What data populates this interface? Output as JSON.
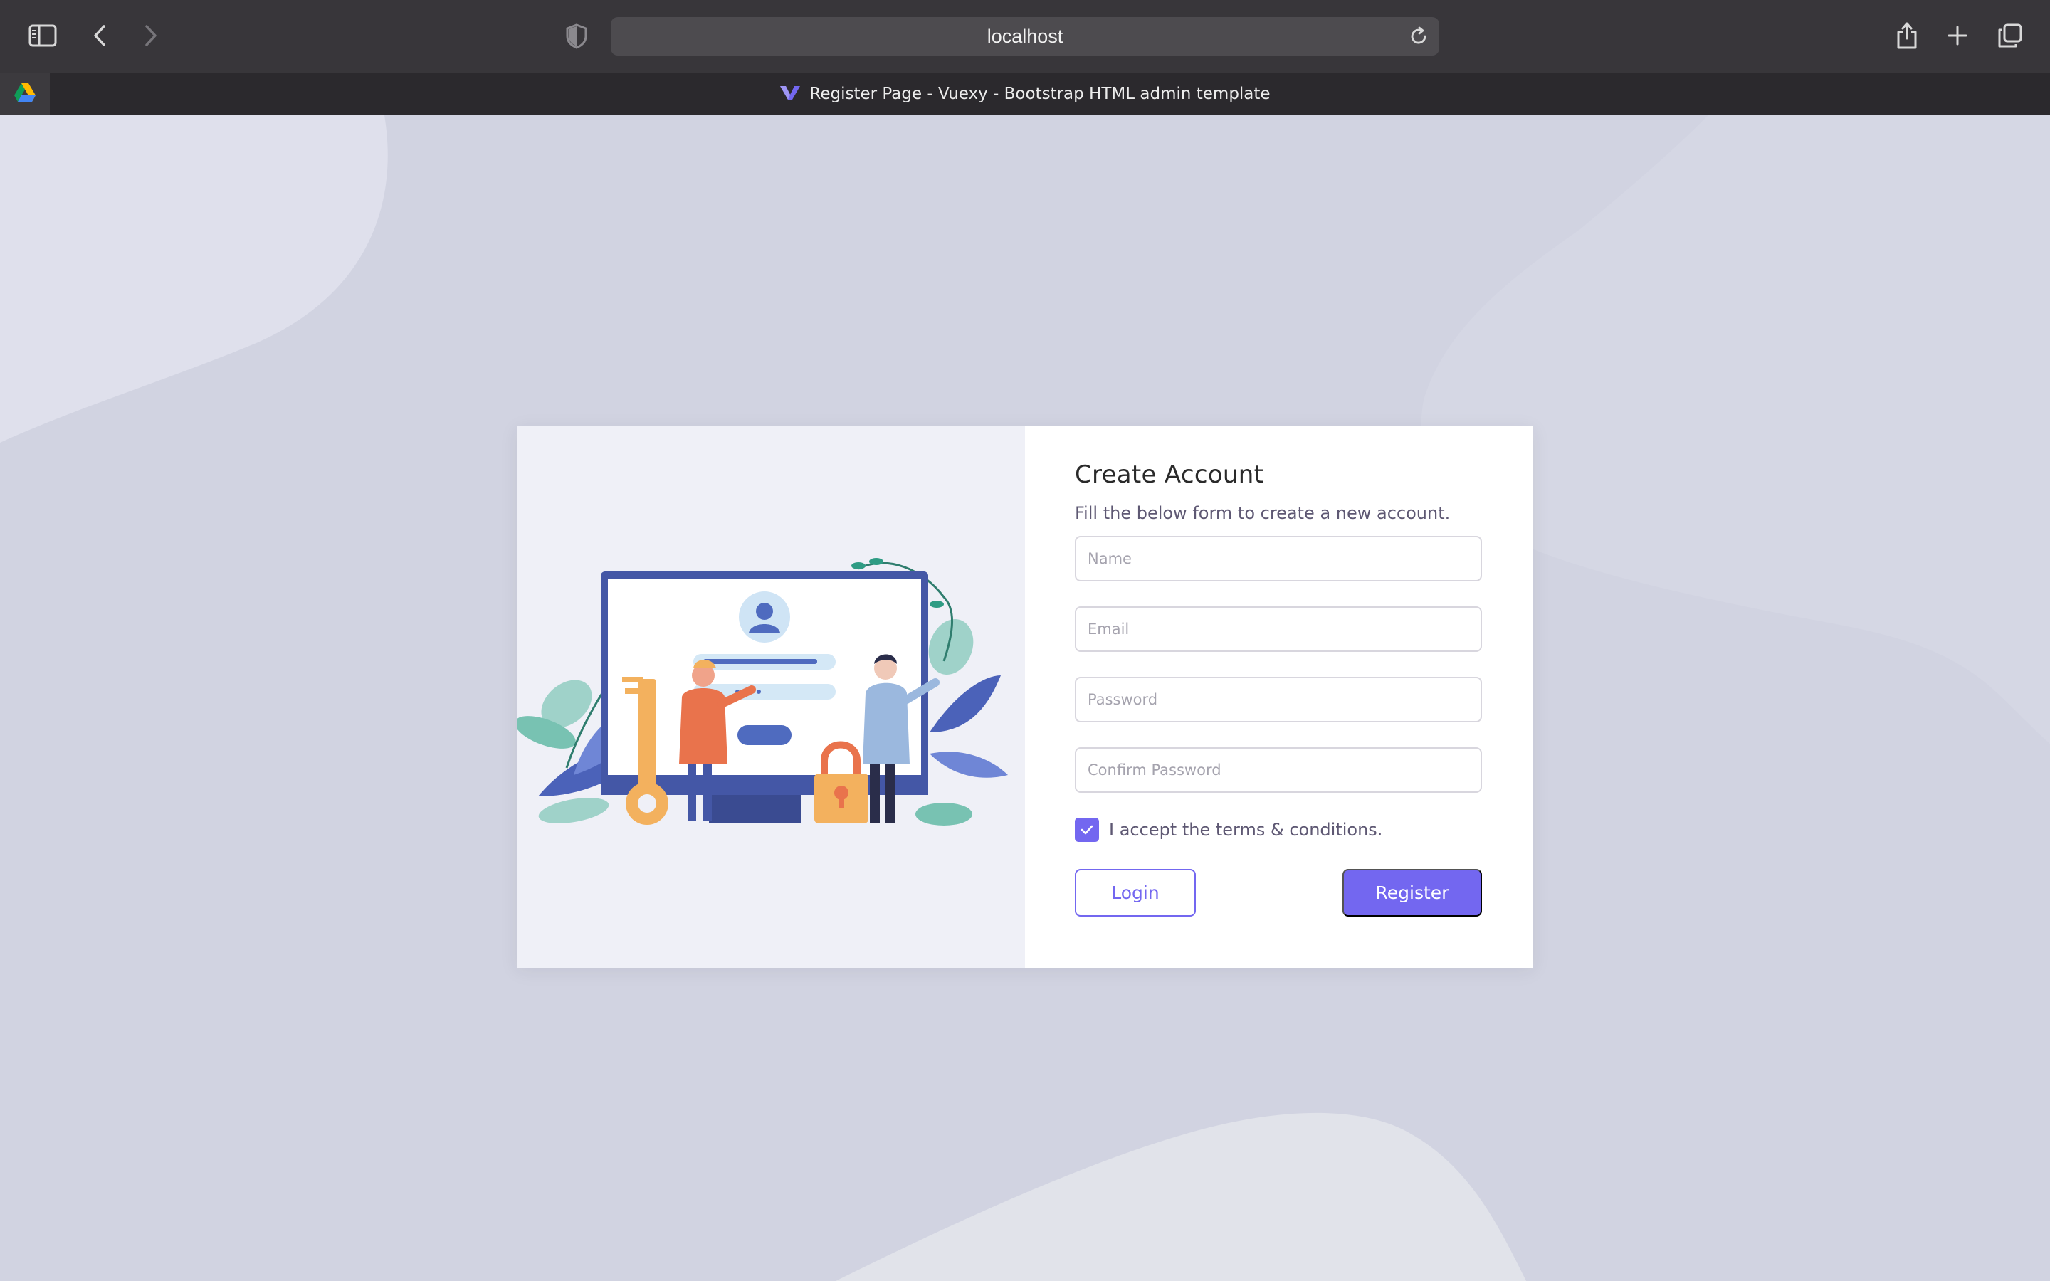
{
  "browser": {
    "url": "localhost",
    "tab_title": "Register Page - Vuexy - Bootstrap HTML admin template",
    "icons": [
      "sidebar-icon",
      "back-icon",
      "forward-icon",
      "shield-icon",
      "reload-icon",
      "share-icon",
      "new-tab-icon",
      "tab-overview-icon",
      "google-drive-icon",
      "vuexy-logo-icon"
    ]
  },
  "form": {
    "title": "Create Account",
    "subtitle": "Fill the below form to create a new account.",
    "name_placeholder": "Name",
    "email_placeholder": "Email",
    "password_placeholder": "Password",
    "confirm_placeholder": "Confirm Password",
    "terms_label": "I accept the terms & conditions.",
    "terms_checked": true,
    "login_label": "Login",
    "register_label": "Register"
  },
  "colors": {
    "primary": "#7367f0",
    "page_bg": "#d1d3e1",
    "illustration_bg": "#eff0f7"
  }
}
